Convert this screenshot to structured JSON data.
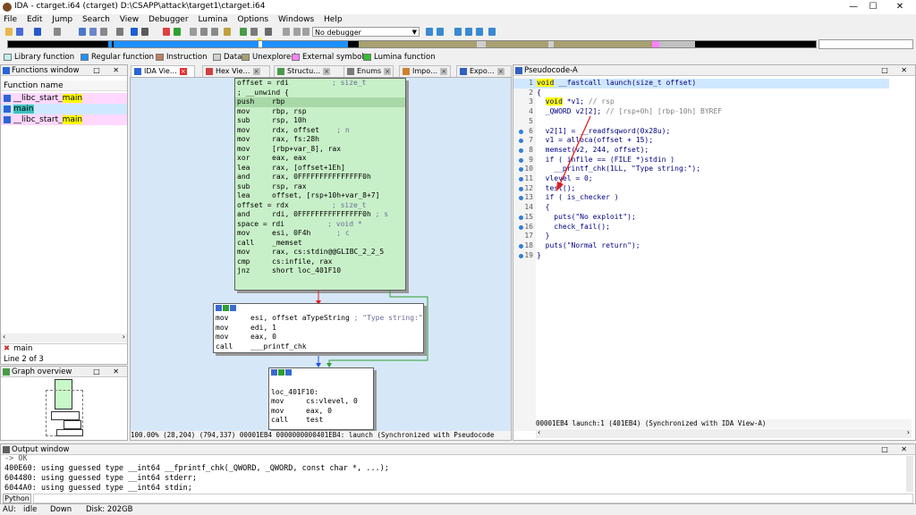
{
  "window": {
    "title": "IDA - ctarget.i64 (ctarget) D:\\CSAPP\\attack\\target1\\ctarget.i64",
    "minimize": "—",
    "maximize": "☐",
    "close": "✕"
  },
  "menu": [
    "File",
    "Edit",
    "Jump",
    "Search",
    "View",
    "Debugger",
    "Lumina",
    "Options",
    "Windows",
    "Help"
  ],
  "toolbar": {
    "debugger_select": "No debugger"
  },
  "legend": [
    {
      "label": "Library function",
      "color": "#c0f0f0"
    },
    {
      "label": "Regular function",
      "color": "#1e90ff"
    },
    {
      "label": "Instruction",
      "color": "#c08060"
    },
    {
      "label": "Data",
      "color": "#d0d0d0"
    },
    {
      "label": "Unexplored",
      "color": "#a8a070"
    },
    {
      "label": "External symbol",
      "color": "#ff80ff"
    },
    {
      "label": "Lumina function",
      "color": "#30c030"
    }
  ],
  "functions_window": {
    "title": "Functions window",
    "column": "Function name",
    "items": [
      {
        "prefix": "__libc_start_",
        "hl": "main",
        "selected": false
      },
      {
        "prefix": "",
        "hl": "main",
        "selected": true
      },
      {
        "prefix": "__libc_start_",
        "hl": "main",
        "selected": false
      }
    ],
    "search_value": "main",
    "line_info": "Line 2 of 3"
  },
  "graph_overview": {
    "title": "Graph overview"
  },
  "tabs": [
    {
      "label": "IDA Vie…",
      "active": true,
      "closable": true
    },
    {
      "label": "Hex Vie…",
      "active": false,
      "closable": true
    },
    {
      "label": "Structu…",
      "active": false,
      "closable": true
    },
    {
      "label": "Enums",
      "active": false,
      "closable": true
    },
    {
      "label": "Impo…",
      "active": false,
      "closable": true
    },
    {
      "label": "Expo…",
      "active": false,
      "closable": true
    }
  ],
  "ida_view": {
    "node1": [
      {
        "m": "offset = rdi",
        "o": "          ",
        "c": "; size_t"
      },
      {
        "m": "; __unwind {",
        "o": "",
        "c": ""
      },
      {
        "m": "push",
        "o": "rbp",
        "c": ""
      },
      {
        "m": "mov",
        "o": "rbp, rsp",
        "c": ""
      },
      {
        "m": "sub",
        "o": "rsp, 10h",
        "c": ""
      },
      {
        "m": "mov",
        "o": "rdx, offset",
        "c": "    ; n"
      },
      {
        "m": "mov",
        "o": "rax, fs:28h",
        "c": ""
      },
      {
        "m": "mov",
        "o": "[rbp+var_8], rax",
        "c": ""
      },
      {
        "m": "xor",
        "o": "eax, eax",
        "c": ""
      },
      {
        "m": "lea",
        "o": "rax, [offset+1Eh]",
        "c": ""
      },
      {
        "m": "and",
        "o": "rax, 0FFFFFFFFFFFFFFF0h",
        "c": ""
      },
      {
        "m": "sub",
        "o": "rsp, rax",
        "c": ""
      },
      {
        "m": "lea",
        "o": "offset, [rsp+10h+var_8+7]",
        "c": ""
      },
      {
        "m": "offset = rdx",
        "o": "          ",
        "c": "; size_t"
      },
      {
        "m": "and",
        "o": "rdi, 0FFFFFFFFFFFFFFF0h",
        "c": " ; s"
      },
      {
        "m": "space = rdi",
        "o": "          ",
        "c": "; void *"
      },
      {
        "m": "mov",
        "o": "esi, 0F4h",
        "c": "      ; c"
      },
      {
        "m": "call",
        "o": "_memset",
        "c": ""
      },
      {
        "m": "mov",
        "o": "rax, cs:stdin@@GLIBC_2_2_5",
        "c": ""
      },
      {
        "m": "cmp",
        "o": "cs:infile, rax",
        "c": ""
      },
      {
        "m": "jnz",
        "o": "short loc_401F10",
        "c": ""
      }
    ],
    "node2": [
      {
        "m": "mov",
        "o": "esi, offset aTypeString",
        "c": " ; \"Type string:\""
      },
      {
        "m": "mov",
        "o": "edi, 1",
        "c": ""
      },
      {
        "m": "mov",
        "o": "eax, 0",
        "c": ""
      },
      {
        "m": "call",
        "o": "___printf_chk",
        "c": ""
      }
    ],
    "node3": [
      {
        "m": "",
        "o": "",
        "c": ""
      },
      {
        "m": "loc_401F10:",
        "o": "",
        "c": ""
      },
      {
        "m": "mov",
        "o": "cs:vlevel, 0",
        "c": ""
      },
      {
        "m": "mov",
        "o": "eax, 0",
        "c": ""
      },
      {
        "m": "call",
        "o": "test",
        "c": ""
      }
    ],
    "status": "100.00% (28,204) (794,337) 00001EB4 0000000000401EB4: launch (Synchronized with Pseudocode"
  },
  "pseudocode": {
    "title": "Pseudocode-A",
    "lines": [
      {
        "n": "1",
        "t": "void __fastcall launch(size_t offset)",
        "dot": false
      },
      {
        "n": "2",
        "t": "{",
        "dot": false
      },
      {
        "n": "3",
        "t": "  void *v1; // rsp",
        "dot": false
      },
      {
        "n": "4",
        "t": "  _QWORD v2[2]; // [rsp+0h] [rbp-10h] BYREF",
        "dot": false
      },
      {
        "n": "5",
        "t": "",
        "dot": false
      },
      {
        "n": "6",
        "t": "  v2[1] = __readfsqword(0x28u);",
        "dot": true
      },
      {
        "n": "7",
        "t": "  v1 = alloca(offset + 15);",
        "dot": true
      },
      {
        "n": "8",
        "t": "  memset(v2, 244, offset);",
        "dot": true
      },
      {
        "n": "9",
        "t": "  if ( infile == (FILE *)stdin )",
        "dot": true
      },
      {
        "n": "10",
        "t": "    __printf_chk(1LL, \"Type string:\");",
        "dot": true
      },
      {
        "n": "11",
        "t": "  vlevel = 0;",
        "dot": true
      },
      {
        "n": "12",
        "t": "  test();",
        "dot": true
      },
      {
        "n": "13",
        "t": "  if ( is_checker )",
        "dot": true
      },
      {
        "n": "14",
        "t": "  {",
        "dot": false
      },
      {
        "n": "15",
        "t": "    puts(\"No exploit\");",
        "dot": true
      },
      {
        "n": "16",
        "t": "    check_fail();",
        "dot": true
      },
      {
        "n": "17",
        "t": "  }",
        "dot": false
      },
      {
        "n": "18",
        "t": "  puts(\"Normal return\");",
        "dot": true
      },
      {
        "n": "19",
        "t": "}",
        "dot": true
      }
    ],
    "status": "00001EB4 launch:1 (401EB4) (Synchronized with IDA View-A)"
  },
  "output": {
    "title": "Output window",
    "lines": [
      "-> OK",
      "400E60: using guessed type __int64 __fprintf_chk(_QWORD, _QWORD, const char *, ...);",
      "604480: using guessed type __int64 stderr;",
      "6044A0: using guessed type __int64 stdin;"
    ],
    "lang_button": "Python"
  },
  "statusbar": {
    "au": "AU:",
    "state": "idle",
    "dir": "Down",
    "disk": "Disk: 202GB"
  },
  "colors": {
    "code_green_bg": "#c8f0c8",
    "selection_bg": "#d0e8ff",
    "lib_pink": "#ffd8ff",
    "keyword_yellow": "#ffff00",
    "edge_red": "#e02020",
    "edge_blue": "#2050e0",
    "edge_green": "#30a030"
  }
}
